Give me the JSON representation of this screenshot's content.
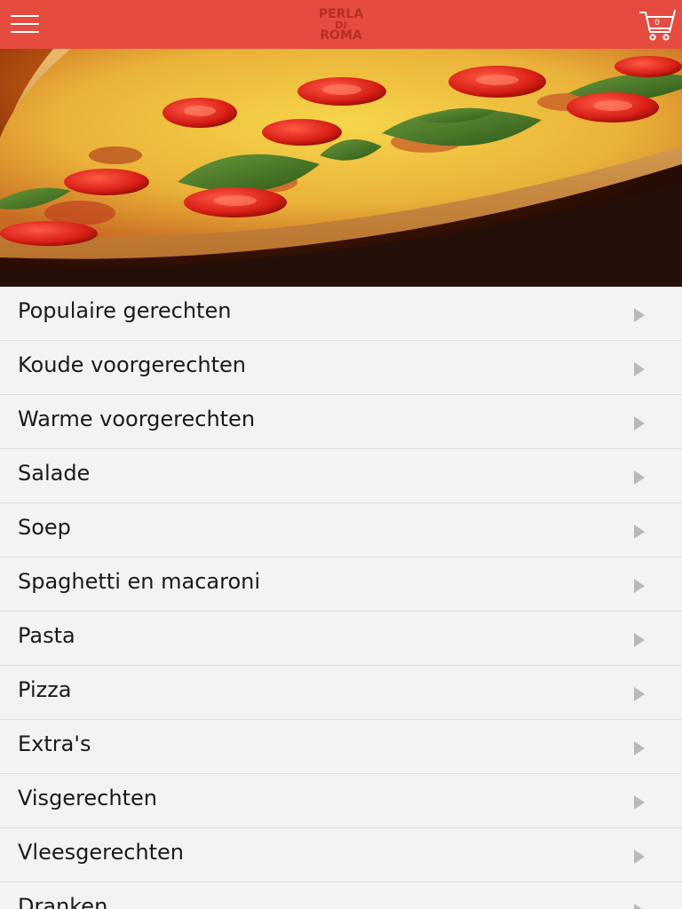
{
  "header": {
    "logo_line1": "PERLA",
    "logo_line2": "DI",
    "logo_line3": "ROMA",
    "cart_count": "0",
    "menu_icon": "hamburger-menu-icon",
    "cart_icon": "shopping-cart-icon"
  },
  "colors": {
    "brand": "#e54c3f",
    "logo": "#b92d25",
    "list_background": "#f3f3f3",
    "divider": "#dcdcdc",
    "chevron": "#b9b9b9"
  },
  "hero": {
    "image_subject": "pizza with tomatoes and basil"
  },
  "categories": [
    {
      "label": "Populaire gerechten"
    },
    {
      "label": "Koude voorgerechten"
    },
    {
      "label": "Warme voorgerechten"
    },
    {
      "label": "Salade"
    },
    {
      "label": "Soep"
    },
    {
      "label": "Spaghetti en macaroni"
    },
    {
      "label": "Pasta"
    },
    {
      "label": "Pizza"
    },
    {
      "label": "Extra's"
    },
    {
      "label": "Visgerechten"
    },
    {
      "label": "Vleesgerechten"
    },
    {
      "label": "Dranken"
    }
  ]
}
